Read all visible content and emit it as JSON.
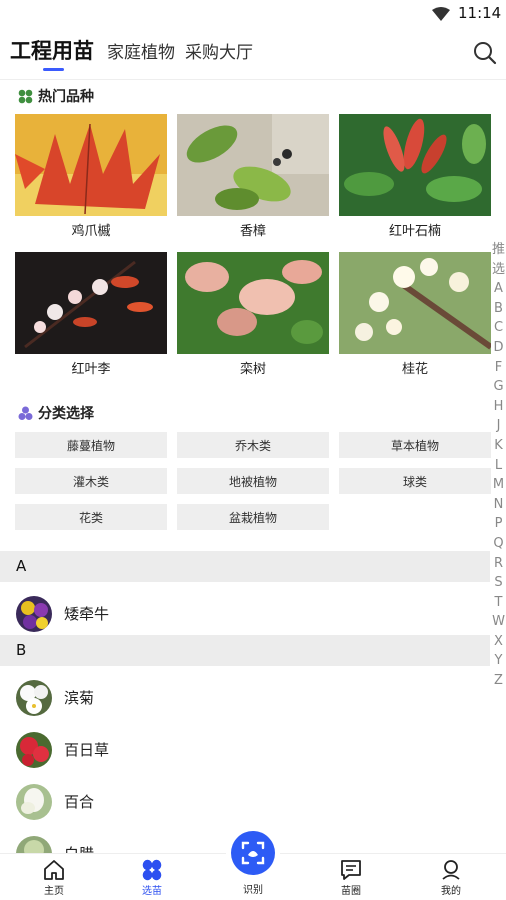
{
  "status_bar": {
    "time": "11:14",
    "icon": "wifi-icon"
  },
  "top_nav": {
    "tabs": [
      {
        "label": "工程用苗",
        "active": true
      },
      {
        "label": "家庭植物",
        "active": false
      },
      {
        "label": "采购大厅",
        "active": false
      }
    ],
    "search_icon": "search-icon",
    "accent": "#3b5bfd"
  },
  "hot_section": {
    "title": "热门品种",
    "icon": "clover-icon",
    "items": [
      {
        "name": "鸡爪槭"
      },
      {
        "name": "香樟"
      },
      {
        "name": "红叶石楠"
      },
      {
        "name": "红叶李"
      },
      {
        "name": "栾树"
      },
      {
        "name": "桂花"
      }
    ]
  },
  "category_section": {
    "title": "分类选择",
    "icon": "category-icon",
    "items": [
      "藤蔓植物",
      "乔木类",
      "草本植物",
      "灌木类",
      "地被植物",
      "球类",
      "花类",
      "盆栽植物"
    ]
  },
  "plant_list": {
    "groups": [
      {
        "letter": "A",
        "items": [
          "矮牵牛"
        ]
      },
      {
        "letter": "B",
        "items": [
          "滨菊",
          "百日草",
          "百合",
          "白腊"
        ]
      }
    ]
  },
  "index_bar": [
    "推",
    "选",
    "A",
    "B",
    "C",
    "D",
    "F",
    "G",
    "H",
    "J",
    "K",
    "L",
    "M",
    "N",
    "P",
    "Q",
    "R",
    "S",
    "T",
    "W",
    "X",
    "Y",
    "Z"
  ],
  "bottom_nav": {
    "items": [
      {
        "label": "主页",
        "icon": "home-icon",
        "active": false
      },
      {
        "label": "选苗",
        "icon": "seedling-select-icon",
        "active": true
      },
      {
        "label": "识别",
        "icon": "scan-identify-icon",
        "active": false
      },
      {
        "label": "苗圈",
        "icon": "chat-icon",
        "active": false
      },
      {
        "label": "我的",
        "icon": "profile-icon",
        "active": false
      }
    ],
    "active_color": "#2d50f0"
  }
}
